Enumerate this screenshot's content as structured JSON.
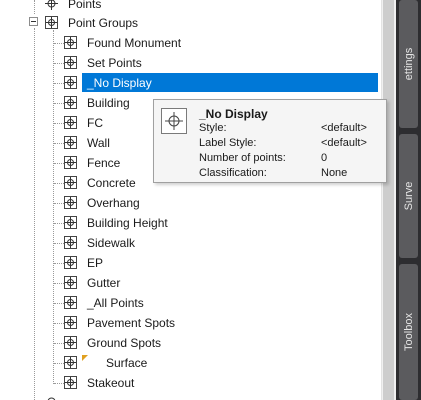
{
  "tree": {
    "points_label": "Points",
    "group_label": "Point Groups",
    "items": [
      {
        "label": "Found Monument"
      },
      {
        "label": "Set Points"
      },
      {
        "label": "_No Display"
      },
      {
        "label": "Building"
      },
      {
        "label": "FC"
      },
      {
        "label": "Wall"
      },
      {
        "label": "Fence"
      },
      {
        "label": "Concrete"
      },
      {
        "label": "Overhang"
      },
      {
        "label": "Building Height"
      },
      {
        "label": "Sidewalk"
      },
      {
        "label": "EP"
      },
      {
        "label": "Gutter"
      },
      {
        "label": "_All Points"
      },
      {
        "label": "Pavement Spots"
      },
      {
        "label": "Ground Spots"
      },
      {
        "label": "Surface"
      },
      {
        "label": "Stakeout"
      }
    ],
    "selected_index": 2
  },
  "tooltip": {
    "title": "_No Display",
    "style_label": "Style:",
    "style_value": "<default>",
    "label_style_label": "Label Style:",
    "label_style_value": "<default>",
    "num_points_label": "Number of points:",
    "num_points_value": "0",
    "classification_label": "Classification:",
    "classification_value": "None"
  },
  "side_tabs": {
    "settings": "ettings",
    "survey": "Surve",
    "toolbox": "Toolbox"
  },
  "colors": {
    "selection": "#0078d7",
    "panel": "#2d2d30",
    "tab": "#5b5b5e"
  }
}
